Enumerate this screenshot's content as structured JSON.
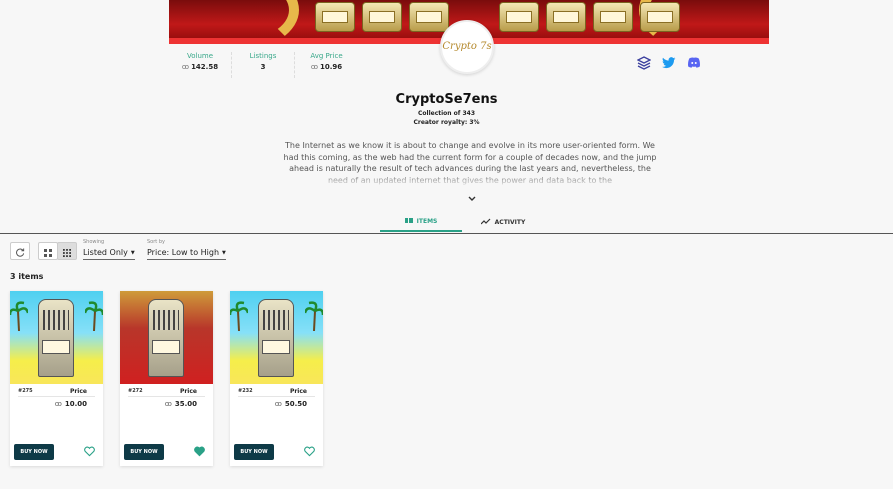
{
  "stats": [
    {
      "label": "Volume",
      "value": "142.58",
      "currency": "ꝏ"
    },
    {
      "label": "Listings",
      "value": "3",
      "currency": ""
    },
    {
      "label": "Avg Price",
      "value": "10.96",
      "currency": "ꝏ"
    }
  ],
  "logo_text": "Crypto 7s",
  "socials": [
    "stack-icon",
    "twitter-icon",
    "discord-icon"
  ],
  "collection": {
    "title": "CryptoSe7ens",
    "size": "Collection of 343",
    "royalty": "Creator royalty: 3%",
    "description": "The Internet as we know it is about to change and evolve in its more user-oriented form. We had this coming, as the web had the current form for a couple of decades now, and the jump ahead is naturally the result of tech advances during the last years and, nevertheless, the need of an updated internet that gives the power and data back to the"
  },
  "tabs": [
    {
      "label": "ITEMS",
      "active": true
    },
    {
      "label": "ACTIVITY",
      "active": false
    }
  ],
  "filters": {
    "showing_label": "Showing",
    "showing_value": "Listed Only",
    "sort_label": "Sort by",
    "sort_value": "Price: Low to High"
  },
  "items_count": "3 items",
  "items": [
    {
      "id": "#275",
      "price_label": "Price",
      "price": "10.00",
      "currency": "ꝏ",
      "buy_label": "BUY NOW",
      "liked": false,
      "theme": "beach"
    },
    {
      "id": "#272",
      "price_label": "Price",
      "price": "35.00",
      "currency": "ꝏ",
      "buy_label": "BUY NOW",
      "liked": true,
      "theme": "red"
    },
    {
      "id": "#232",
      "price_label": "Price",
      "price": "50.50",
      "currency": "ꝏ",
      "buy_label": "BUY NOW",
      "liked": false,
      "theme": "beach"
    }
  ],
  "colors": {
    "accent": "#2aa187",
    "buy_button": "#0e3a47"
  }
}
